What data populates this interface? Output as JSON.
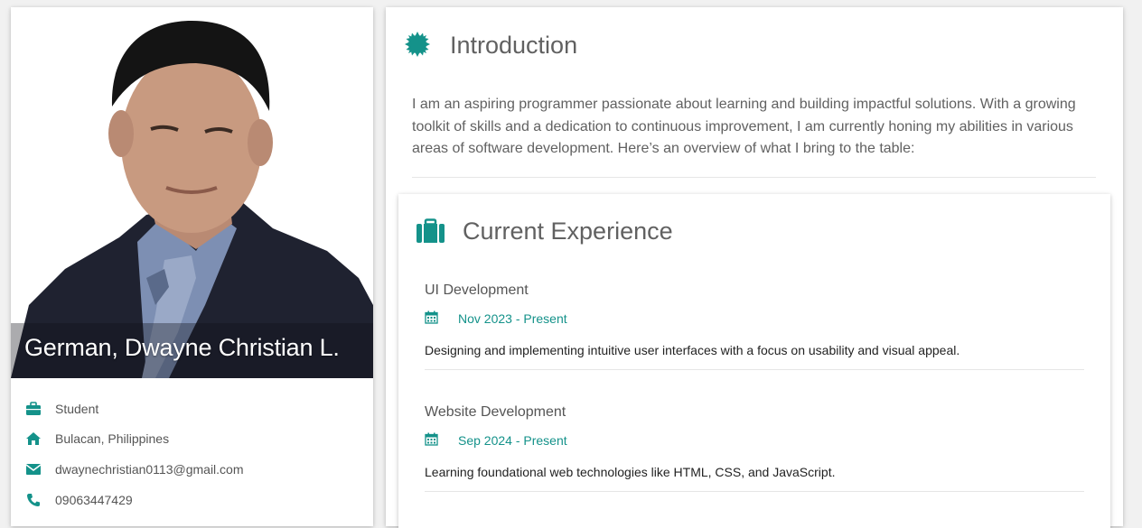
{
  "profile": {
    "name": "German, Dwayne Christian L.",
    "photo_alt": "Profile photo",
    "info": [
      {
        "icon": "briefcase-icon",
        "text": "Student"
      },
      {
        "icon": "home-icon",
        "text": "Bulacan, Philippines"
      },
      {
        "icon": "envelope-icon",
        "text": "dwaynechristian0113@gmail.com"
      },
      {
        "icon": "phone-icon",
        "text": "09063447429"
      }
    ]
  },
  "intro": {
    "icon": "certificate-icon",
    "title": "Introduction",
    "text": "I am an aspiring programmer passionate about learning and building impactful solutions. With a growing toolkit of skills and a dedication to continuous improvement, I am currently honing my abilities in various areas of software development. Here’s an overview of what I bring to the table:"
  },
  "experience": {
    "icon": "suitcase-icon",
    "title": "Current Experience",
    "jobs": [
      {
        "title": "UI Development",
        "date_icon": "calendar-icon",
        "date": "Nov 2023 - Present",
        "description": "Designing and implementing intuitive user interfaces with a focus on usability and visual appeal."
      },
      {
        "title": "Website Development",
        "date_icon": "calendar-icon",
        "date": "Sep 2024 - Present",
        "description": "Learning foundational web technologies like HTML, CSS, and JavaScript."
      }
    ]
  },
  "colors": {
    "accent": "#14928a",
    "text": "#616161",
    "background": "#f1f1f1"
  }
}
